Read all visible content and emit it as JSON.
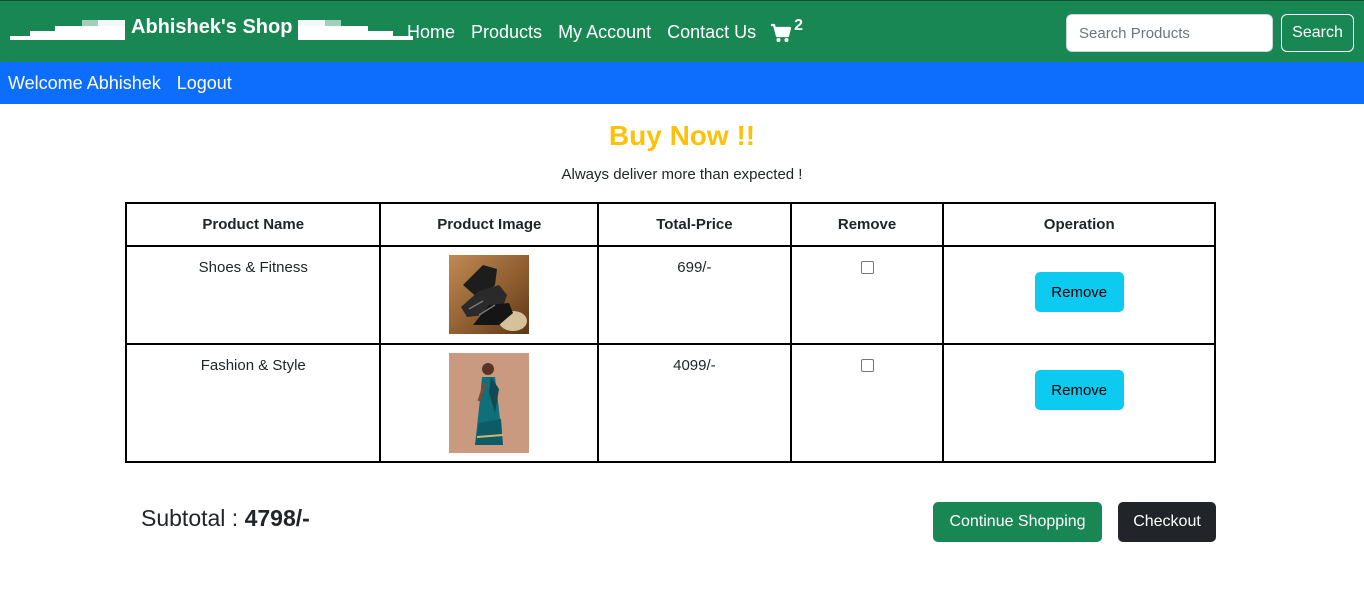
{
  "header": {
    "brand": "Abhishek's Shop",
    "nav": [
      "Home",
      "Products",
      "My Account",
      "Contact Us"
    ],
    "cart_icon": "cart-icon",
    "cart_count": "2",
    "search_placeholder": "Search Products",
    "search_button": "Search"
  },
  "subnav": {
    "welcome": "Welcome Abhishek",
    "logout": "Logout"
  },
  "main": {
    "heading": "Buy Now !!",
    "tagline": "Always deliver more than expected !",
    "table": {
      "headers": [
        "Product Name",
        "Product Image",
        "Total-Price",
        "Remove",
        "Operation"
      ],
      "rows": [
        {
          "name": "Shoes & Fitness",
          "image": "shoes-image",
          "price": "699/-",
          "remove_checked": false,
          "operation": "Remove"
        },
        {
          "name": "Fashion & Style",
          "image": "saree-image",
          "price": "4099/-",
          "remove_checked": false,
          "operation": "Remove"
        }
      ]
    },
    "subtotal_label": "Subtotal : ",
    "subtotal_value": "4798/-",
    "continue_button": "Continue Shopping",
    "checkout_button": "Checkout"
  },
  "colors": {
    "navbar": "#198754",
    "subnav": "#0d6efd",
    "heading": "#ffc107",
    "remove_button": "#0dcaf0",
    "checkout_button": "#212529"
  }
}
